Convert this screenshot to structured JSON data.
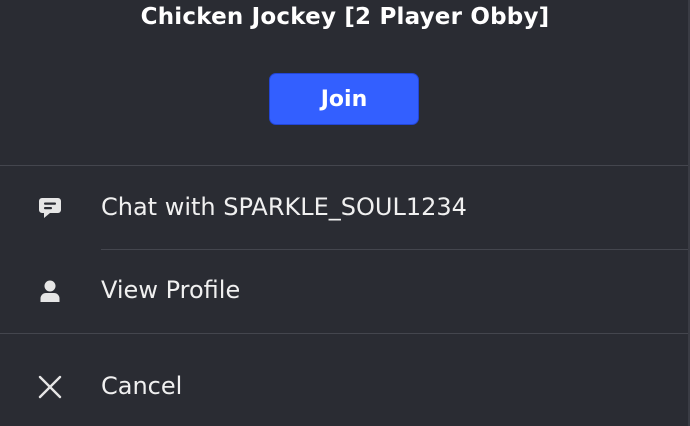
{
  "header": {
    "title": "Chicken Jockey [2 Player Obby]",
    "join_label": "Join"
  },
  "menu": {
    "items": [
      {
        "label": "Chat with SPARKLE_SOUL1234",
        "icon": "chat-icon"
      },
      {
        "label": "View Profile",
        "icon": "profile-icon"
      },
      {
        "label": "Cancel",
        "icon": "close-icon"
      }
    ]
  },
  "colors": {
    "background": "#2a2c33",
    "accent": "#335fff",
    "divider": "#44464e",
    "text": "#f0f0f0"
  }
}
